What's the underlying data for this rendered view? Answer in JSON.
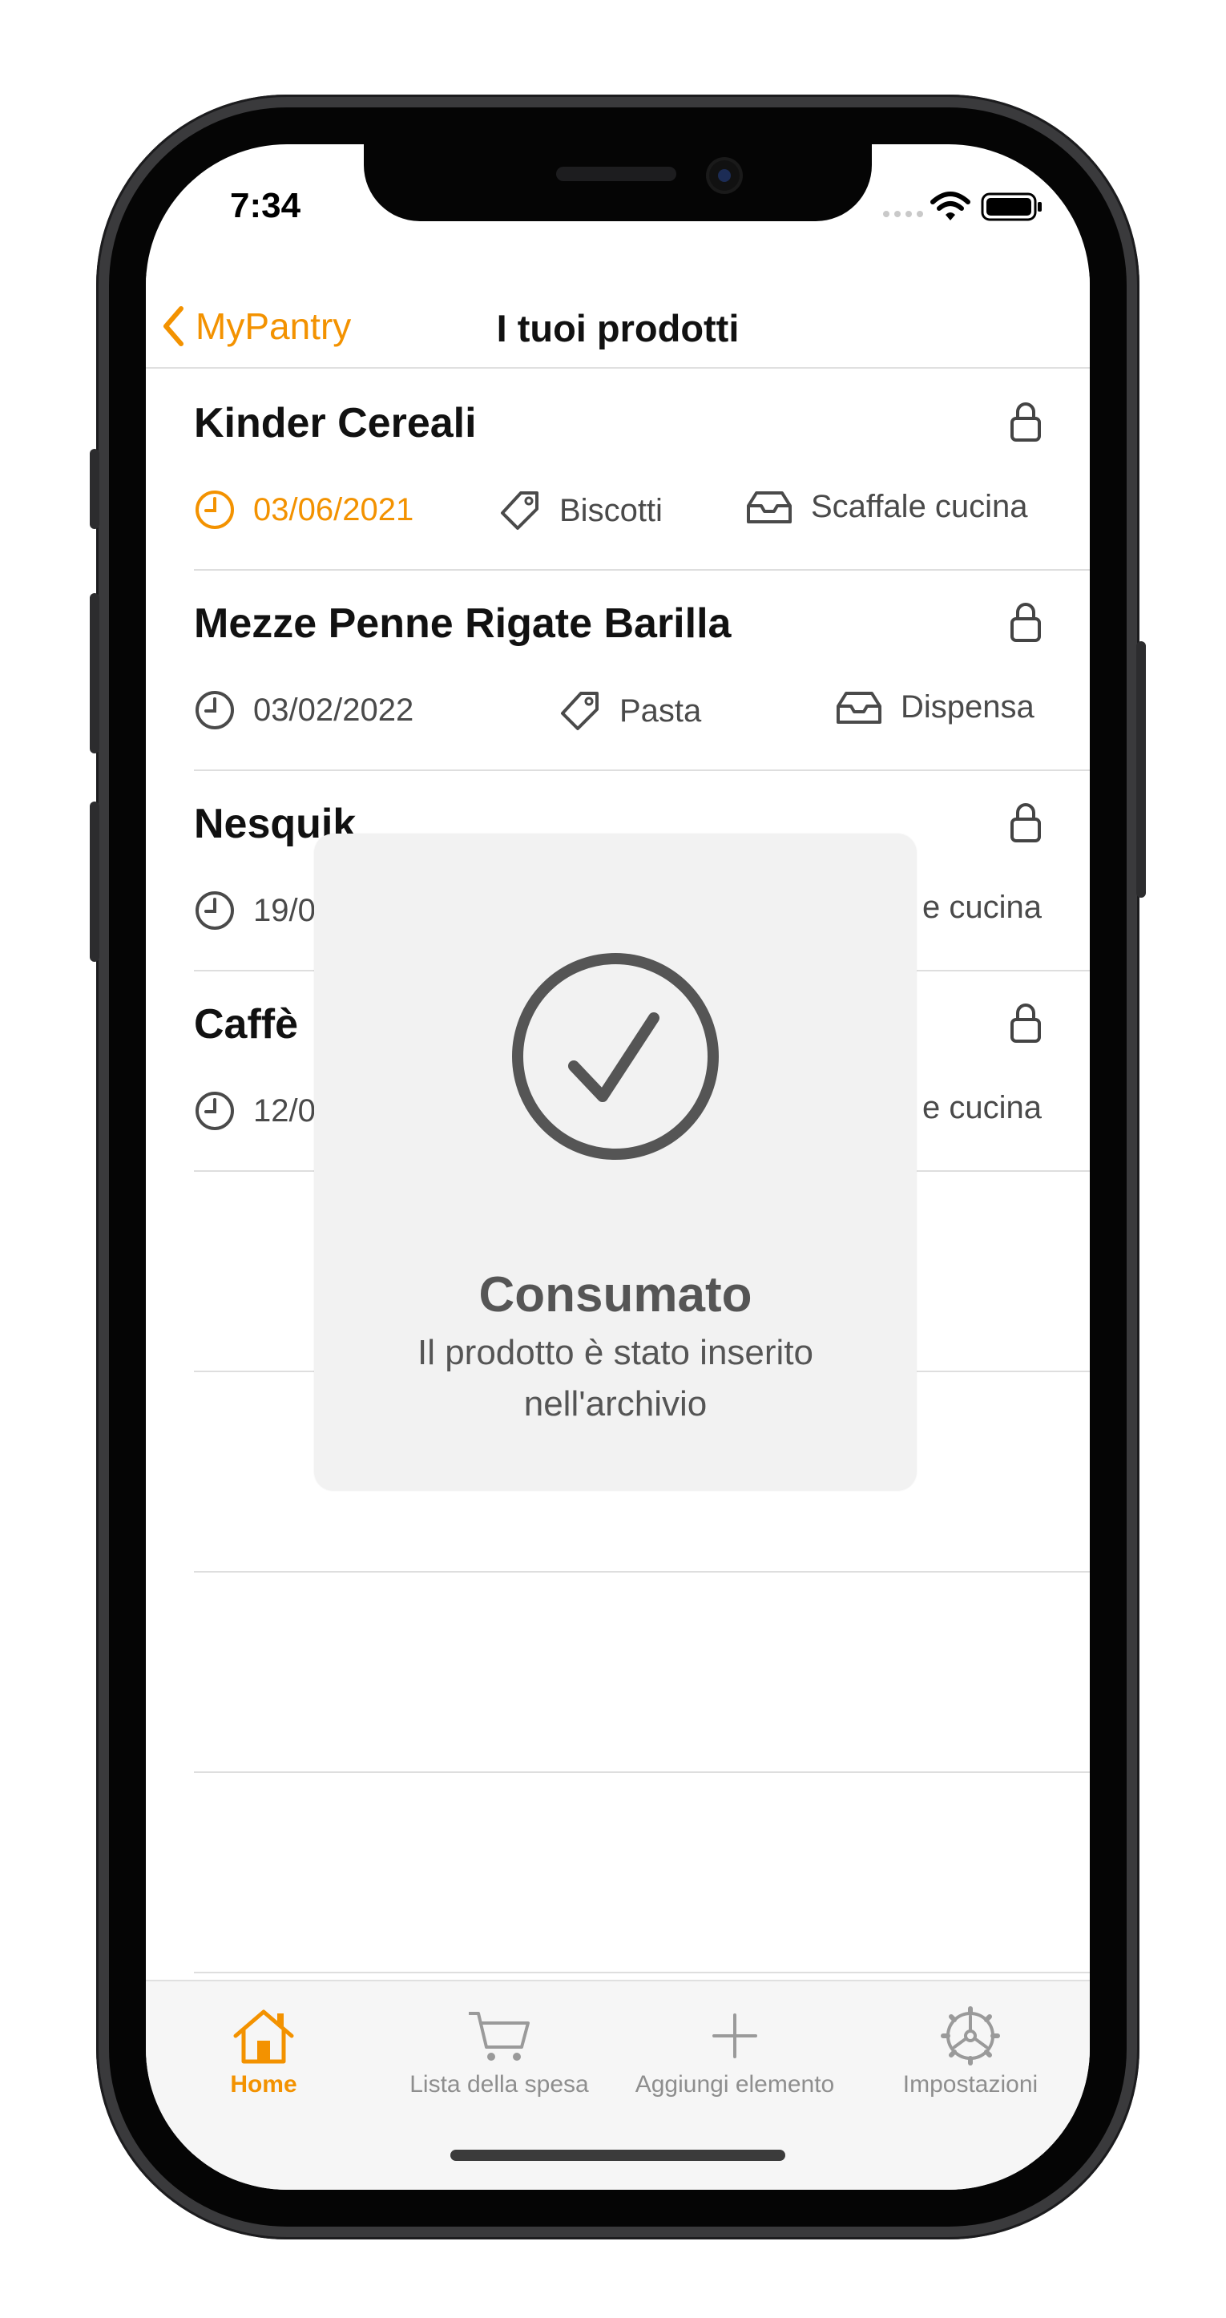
{
  "status_bar": {
    "time": "7:34"
  },
  "nav": {
    "back_label": "MyPantry",
    "title": "I tuoi prodotti"
  },
  "products": [
    {
      "name": "Kinder Cereali",
      "date": "03/06/2021",
      "category": "Biscotti",
      "location": "Scaffale cucina",
      "date_highlight": true
    },
    {
      "name": "Mezze Penne Rigate Barilla",
      "date": "03/02/2022",
      "category": "Pasta",
      "location": "Dispensa",
      "date_highlight": false
    },
    {
      "name": "Nesquik",
      "date": "19/0",
      "location": "e cucina"
    },
    {
      "name": "Caffè",
      "date": "12/0",
      "location": "e cucina"
    }
  ],
  "hud": {
    "title": "Consumato",
    "message": "Il prodotto è stato inserito nell'archivio"
  },
  "tab_bar": {
    "tabs": [
      {
        "label": "Home",
        "icon": "home-icon",
        "active": true
      },
      {
        "label": "Lista della spesa",
        "icon": "cart-icon",
        "active": false
      },
      {
        "label": "Aggiungi elemento",
        "icon": "plus-icon",
        "active": false
      },
      {
        "label": "Impostazioni",
        "icon": "gear-icon",
        "active": false
      }
    ]
  },
  "colors": {
    "accent": "#f39200",
    "text": "#111111",
    "secondary": "#4a4a4a",
    "hud_bg": "#f2f2f2"
  }
}
